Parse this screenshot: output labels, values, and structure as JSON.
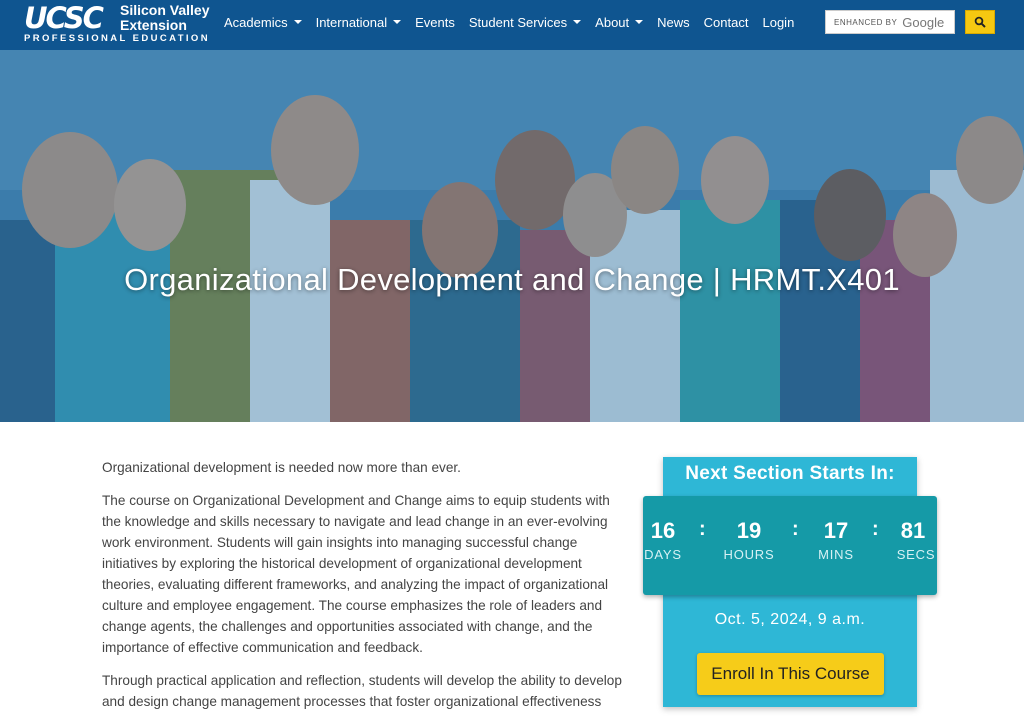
{
  "logo": {
    "ucsc": "UCSC",
    "line1": "Silicon Valley",
    "line2": "Extension",
    "tagline": "PROFESSIONAL EDUCATION"
  },
  "nav": {
    "items": [
      {
        "label": "Academics",
        "dropdown": true
      },
      {
        "label": "International",
        "dropdown": true
      },
      {
        "label": "Events",
        "dropdown": false
      },
      {
        "label": "Student Services",
        "dropdown": true
      },
      {
        "label": "About",
        "dropdown": true
      },
      {
        "label": "News",
        "dropdown": false
      },
      {
        "label": "Contact",
        "dropdown": false
      },
      {
        "label": "Login",
        "dropdown": false
      }
    ]
  },
  "search": {
    "enhanced_label": "ENHANCED BY",
    "google_label": "Google",
    "icon": "search-icon"
  },
  "hero": {
    "title": "Organizational Development and Change | HRMT.X401"
  },
  "content": {
    "paragraphs": [
      "Organizational development is needed now more than ever.",
      "The course on Organizational Development and Change aims to equip students with the knowledge and skills necessary to navigate and lead change in an ever-evolving work environment. Students will gain insights into managing successful change initiatives by exploring the historical development of organizational development theories, evaluating different frameworks, and analyzing the impact of organizational culture and employee engagement. The course emphasizes the role of leaders and change agents, the challenges and opportunities associated with change, and the importance of effective communication and feedback.",
      "Through practical application and reflection, students will develop the ability to develop and design change management processes that foster organizational effectiveness"
    ]
  },
  "sidebar": {
    "next_title": "Next Section Starts In:",
    "countdown": {
      "days": "16",
      "days_label": "DAYS",
      "hours": "19",
      "hours_label": "HOURS",
      "mins": "17",
      "mins_label": "MINS",
      "secs": "81",
      "secs_label": "SECS",
      "separator": ":"
    },
    "date": "Oct. 5, 2024, 9 a.m.",
    "enroll_label": "Enroll In This Course"
  },
  "colors": {
    "nav_bg": "#0f5590",
    "accent_yellow": "#f6cc19",
    "card_blue": "#2eb7d6",
    "countdown_teal": "#159aa7"
  }
}
